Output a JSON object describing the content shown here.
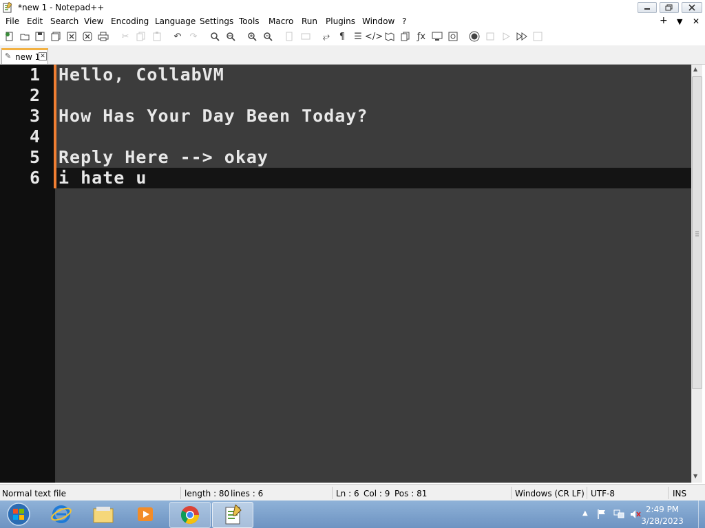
{
  "window": {
    "title": "*new 1 - Notepad++"
  },
  "menu": [
    "File",
    "Edit",
    "Search",
    "View",
    "Encoding",
    "Language",
    "Settings",
    "Tools",
    "Macro",
    "Run",
    "Plugins",
    "Window",
    "?"
  ],
  "menu_right": {
    "plus": "+",
    "dropdown": "▼",
    "close": "✕"
  },
  "toolbar": {
    "icons": [
      "new-file-icon",
      "open-file-icon",
      "save-icon",
      "save-all-icon",
      "close-icon",
      "close-all-icon",
      "print-icon",
      "cut-icon",
      "copy-icon",
      "paste-icon",
      "undo-icon",
      "redo-icon",
      "find-icon",
      "replace-icon",
      "zoom-in-icon",
      "zoom-out-icon",
      "sync-vertical-icon",
      "sync-horizontal-icon",
      "word-wrap-icon",
      "show-all-chars-icon",
      "indent-guide-icon",
      "lang-xml-icon",
      "doc-map-icon",
      "doc-list-icon",
      "function-list-icon",
      "folder-workspace-icon",
      "monitoring-icon",
      "record-macro-icon",
      "stop-macro-icon",
      "play-macro-icon",
      "run-macro-multiple-icon",
      "save-macro-icon"
    ]
  },
  "tab": {
    "label": "new 1"
  },
  "editor": {
    "lines": [
      {
        "number": "1",
        "text": "Hello, CollabVM"
      },
      {
        "number": "2",
        "text": ""
      },
      {
        "number": "3",
        "text": "How Has Your Day Been Today?"
      },
      {
        "number": "4",
        "text": ""
      },
      {
        "number": "5",
        "text": "Reply Here --> okay"
      },
      {
        "number": "6",
        "text": "i hate u"
      }
    ],
    "current_line": 6,
    "colors": {
      "background": "#3c3c3c",
      "gutter": "#0f0f0f",
      "text": "#e8e8e8",
      "change_marker": "#f07e32",
      "current_line": "#141414"
    }
  },
  "status": {
    "file_type": "Normal text file",
    "length": "length : 80",
    "lines": "lines : 6",
    "ln": "Ln : 6",
    "col": "Col : 9",
    "pos": "Pos : 81",
    "eol": "Windows (CR LF)",
    "encoding": "UTF-8",
    "mode": "INS"
  },
  "taskbar": {
    "apps": [
      "start-orb-icon",
      "internet-explorer-icon",
      "file-explorer-icon",
      "media-player-icon",
      "chrome-icon",
      "notepad-plus-plus-icon"
    ],
    "clock_time": "2:49 PM",
    "clock_date": "3/28/2023"
  }
}
